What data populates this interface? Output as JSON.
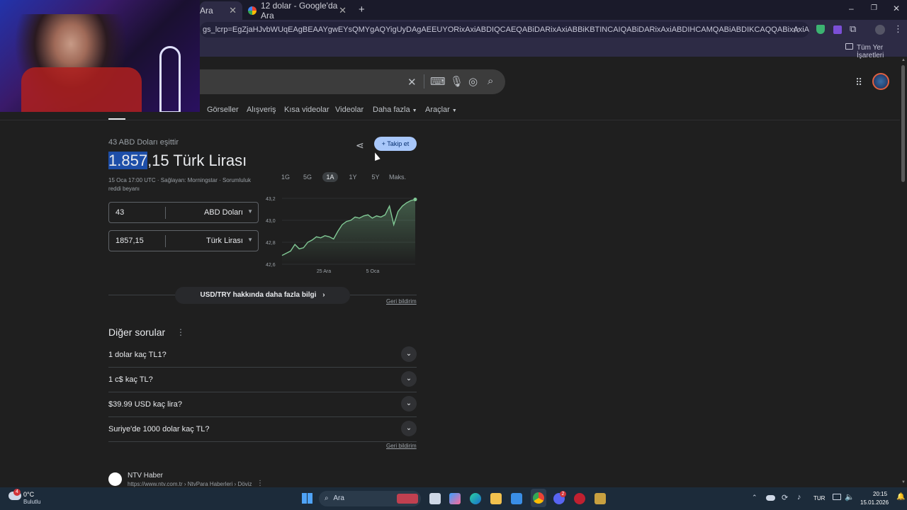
{
  "browser": {
    "tabs": [
      {
        "label": "Ara"
      },
      {
        "label": "12 dolar - Google'da Ara"
      }
    ],
    "url": "gs_lcrp=EgZjaHJvbWUqEAgBEAAYgwEYsQMYgAQYigUyDAgAEEUYORixAxiABDIQCAEQABiDARixAxiABBiKBTINCAIQABiDARixAxiABDIHCAMQABiABDIKCAQQABixAxiABDIHCAUQABiABDIHCAYQABiABDI...",
    "bookmarks_label": "Tüm Yer İşaretleri",
    "colors": {
      "tab_bar": "#1a1a2a",
      "toolbar": "#2d2b45"
    }
  },
  "search": {
    "nav_tabs": [
      "Görseller",
      "Alışveriş",
      "Kısa videolar",
      "Videolar",
      "Daha fazla",
      "Araçlar"
    ]
  },
  "converter": {
    "subtitle": "43 ABD Doları eşittir",
    "result_highlight": "1.857",
    "result_rest": ",15 Türk Lirası",
    "source": "15 Oca 17:00 UTC · Sağlayan: Morningstar · Sorumluluk reddi beyanı",
    "follow_button": "Takip et",
    "from": {
      "value": "43",
      "currency": "ABD Doları"
    },
    "to": {
      "value": "1857,15",
      "currency": "Türk Lirası"
    },
    "ranges": [
      "1G",
      "5G",
      "1A",
      "1Y",
      "5Y",
      "Maks."
    ],
    "active_range": "1A",
    "more_info": "USD/TRY hakkında daha fazla bilgi",
    "feedback": "Geri bildirim"
  },
  "chart_data": {
    "type": "line",
    "title": "",
    "x_labels": [
      "25 Ara",
      "5 Oca"
    ],
    "y_ticks": [
      "43,2",
      "43,0",
      "42,8",
      "42,6"
    ],
    "ylim": [
      42.6,
      43.2
    ],
    "grid": true,
    "color": "#81c995",
    "series": [
      {
        "values": [
          42.68,
          42.7,
          42.72,
          42.78,
          42.74,
          42.75,
          42.8,
          42.82,
          42.85,
          42.84,
          42.86,
          42.85,
          42.83,
          42.9,
          42.96,
          42.99,
          43.0,
          43.03,
          43.02,
          43.04,
          43.05,
          43.02,
          43.04,
          43.03,
          43.05,
          43.13,
          42.96,
          43.08,
          43.13,
          43.16,
          43.18,
          43.19
        ]
      }
    ]
  },
  "other_questions": {
    "title": "Diğer sorular",
    "items": [
      "1 dolar kaç TL1?",
      "1 c$ kaç TL?",
      "$39.99 USD kaç lira?",
      "Suriye'de 1000 dolar kaç TL?"
    ],
    "feedback": "Geri bildirim"
  },
  "result": {
    "site": "NTV Haber",
    "url": "https://www.ntv.com.tr › NtvPara Haberleri › Döviz"
  },
  "taskbar": {
    "weather_temp": "0°C",
    "weather_desc": "Bulutlu",
    "search_placeholder": "Ara",
    "lang": "TUR",
    "time": "20:15",
    "date": "15.01.2026",
    "badges": {
      "weather": "4",
      "discord": "2"
    }
  }
}
